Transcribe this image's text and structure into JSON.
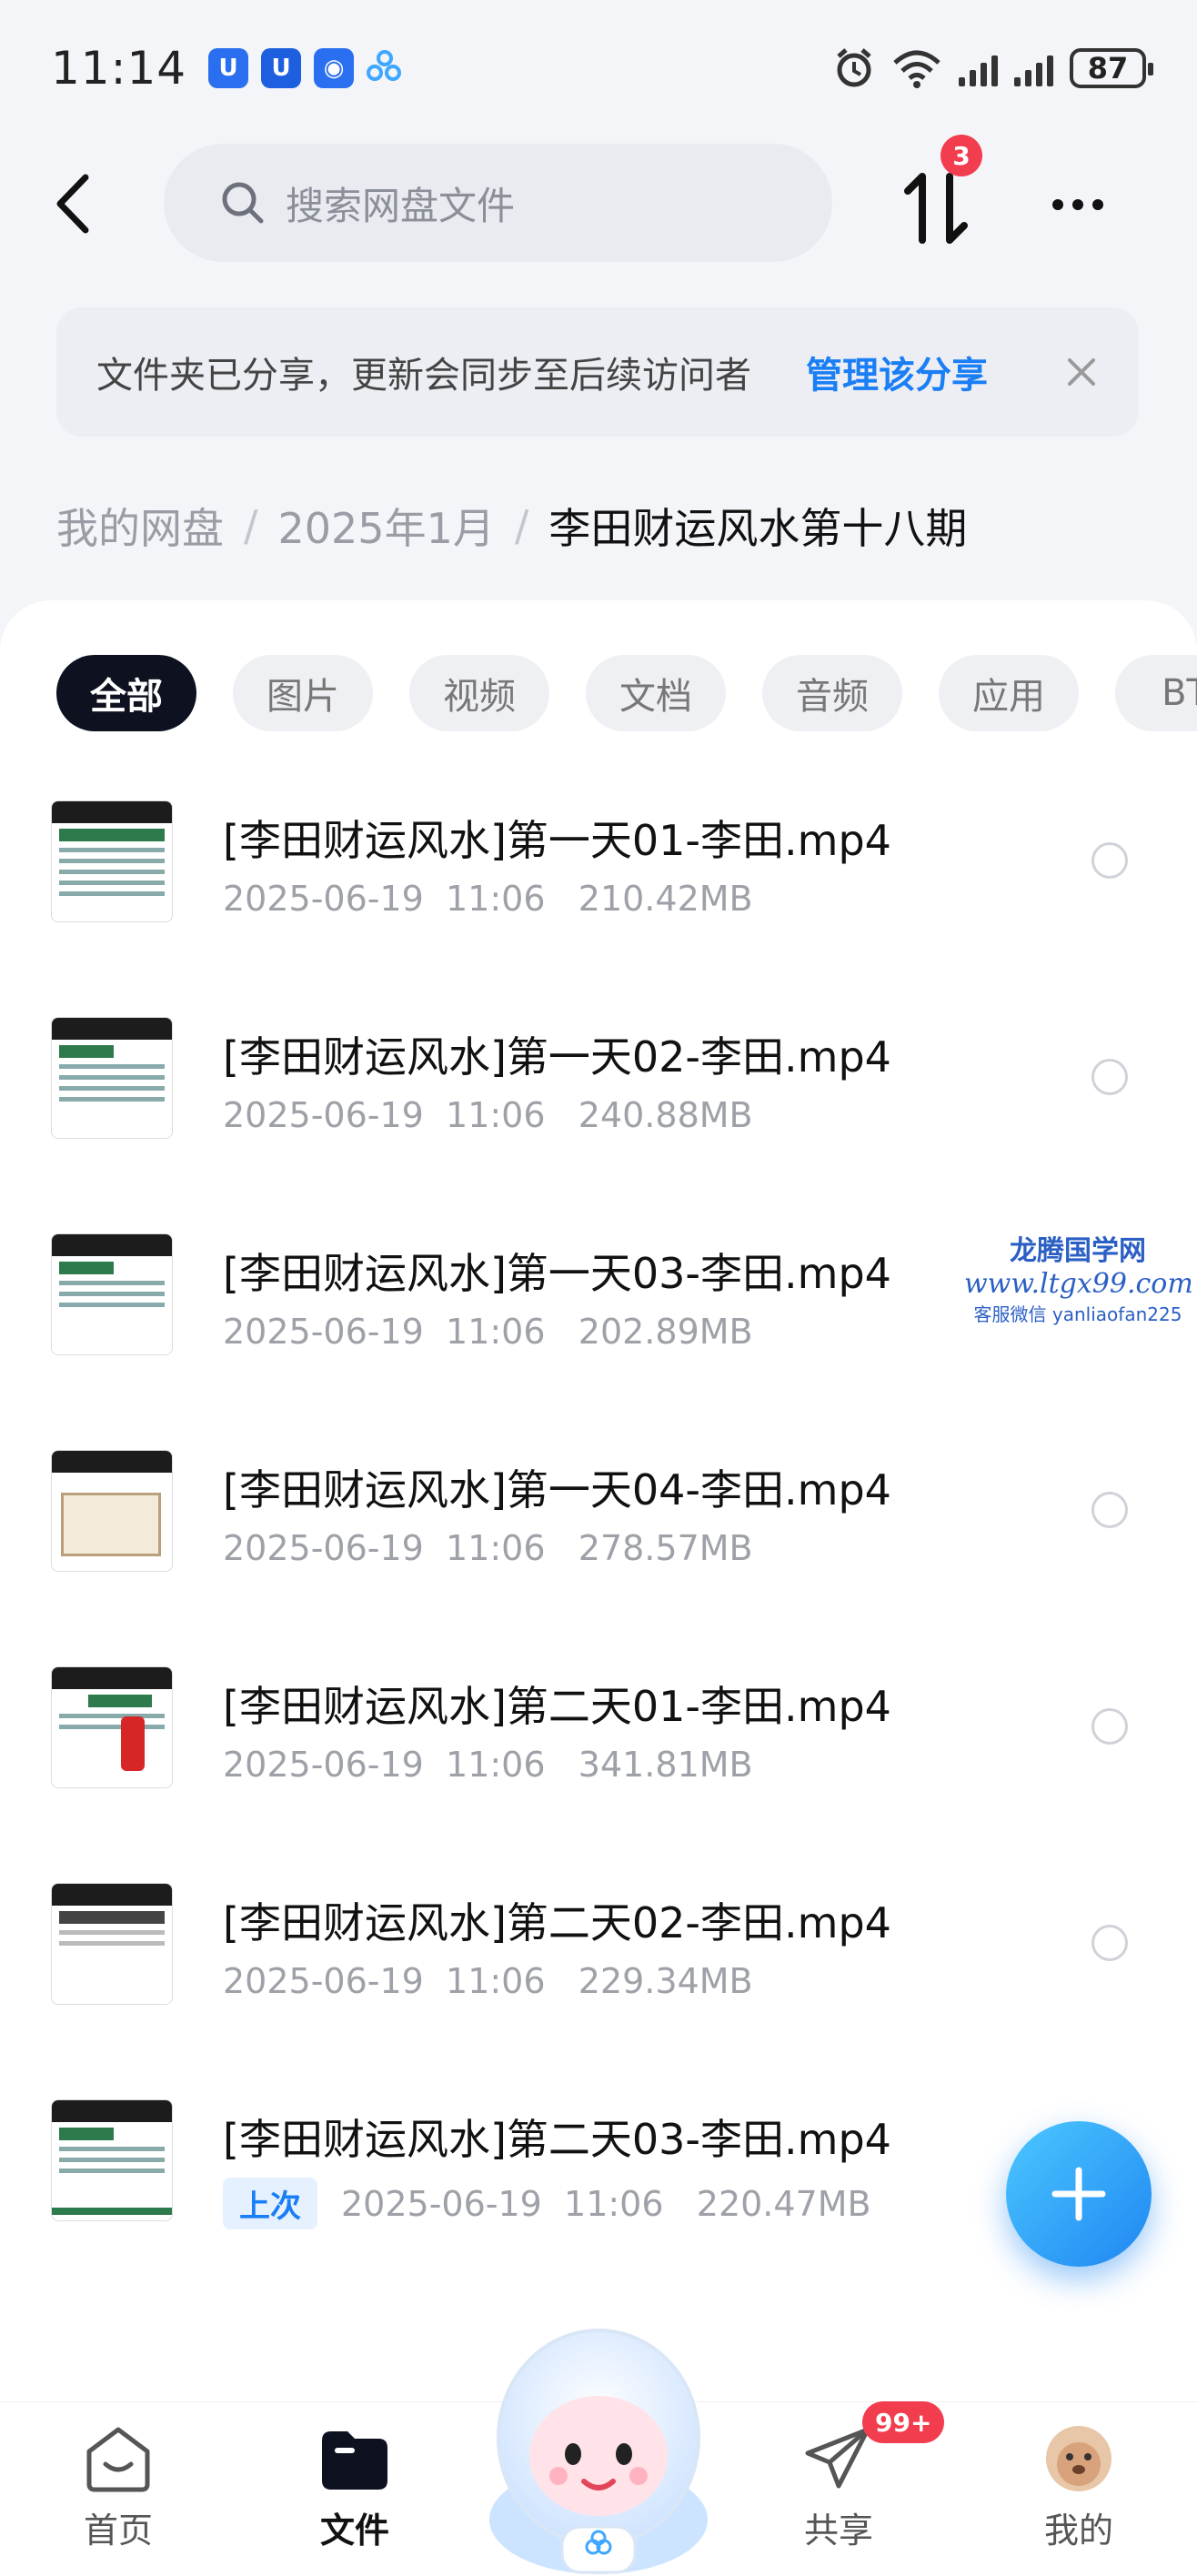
{
  "status_bar": {
    "time": "11:14",
    "battery": "87",
    "icons": [
      "alarm-icon",
      "wifi-icon",
      "signal-icon",
      "signal-icon",
      "battery-icon"
    ]
  },
  "header": {
    "search_placeholder": "搜索网盘文件",
    "transfer_badge": "3"
  },
  "share_notice": {
    "text": "文件夹已分享，更新会同步至后续访问者",
    "link": "管理该分享"
  },
  "breadcrumb": {
    "items": [
      "我的网盘",
      "2025年1月"
    ],
    "current": "李田财运风水第十八期"
  },
  "filters": [
    "全部",
    "图片",
    "视频",
    "文档",
    "音频",
    "应用",
    "BT"
  ],
  "files": [
    {
      "name": "[李田财运风水]第一天01-李田.mp4",
      "date": "2025-06-19",
      "time": "11:06",
      "size": "210.42MB"
    },
    {
      "name": "[李田财运风水]第一天02-李田.mp4",
      "date": "2025-06-19",
      "time": "11:06",
      "size": "240.88MB"
    },
    {
      "name": "[李田财运风水]第一天03-李田.mp4",
      "date": "2025-06-19",
      "time": "11:06",
      "size": "202.89MB"
    },
    {
      "name": "[李田财运风水]第一天04-李田.mp4",
      "date": "2025-06-19",
      "time": "11:06",
      "size": "278.57MB"
    },
    {
      "name": "[李田财运风水]第二天01-李田.mp4",
      "date": "2025-06-19",
      "time": "11:06",
      "size": "341.81MB"
    },
    {
      "name": "[李田财运风水]第二天02-李田.mp4",
      "date": "2025-06-19",
      "time": "11:06",
      "size": "229.34MB"
    },
    {
      "name": "[李田财运风水]第二天03-李田.mp4",
      "date": "2025-06-19",
      "time": "11:06",
      "size": "220.47MB",
      "tag": "上次"
    }
  ],
  "watermark": {
    "line1": "龙腾国学网",
    "line2": "www.ltgx99.com",
    "line3": "客服微信 yanliaofan225"
  },
  "bottom_nav": {
    "items": [
      "首页",
      "文件",
      "共享",
      "我的"
    ],
    "share_badge": "99+"
  }
}
